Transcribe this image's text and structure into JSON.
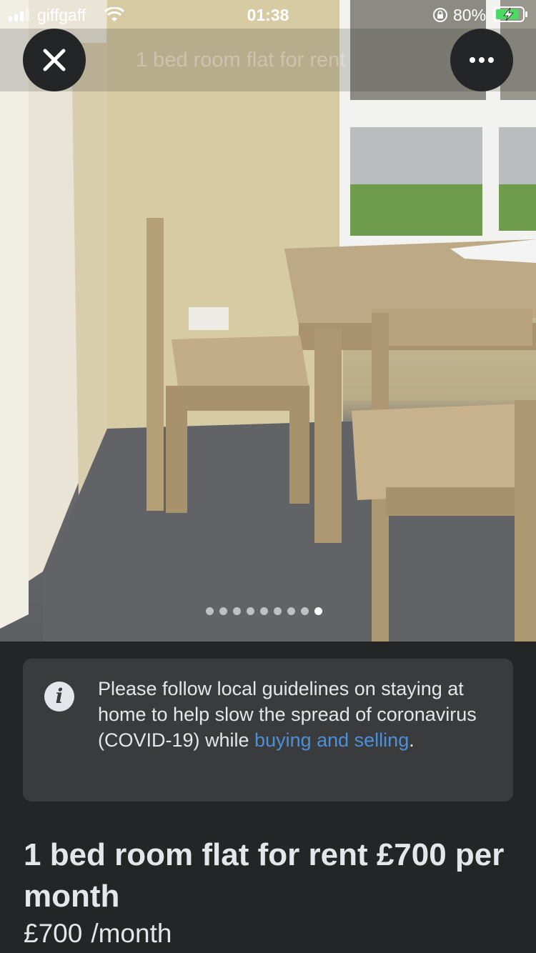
{
  "status_bar": {
    "carrier": "giffgaff",
    "time": "01:38",
    "battery_percent": "80%"
  },
  "header": {
    "faded_title": "1 bed room flat for rent"
  },
  "gallery": {
    "image_count": 9,
    "active_index": 9
  },
  "notice": {
    "text": "Please follow local guidelines on staying at home to help slow the spread of coronavirus (COVID-19) while ",
    "link_text": "buying and selling",
    "suffix": "."
  },
  "listing": {
    "title": "1 bed room flat for rent £700 per month",
    "price": "£700",
    "price_unit": "/month"
  },
  "icons": {
    "close": "close-icon",
    "more": "more-options-icon",
    "info": "info-icon"
  },
  "colors": {
    "background": "#242526",
    "card": "#3a3b3c",
    "link": "#4e8fd9",
    "text": "#e4e6eb"
  }
}
